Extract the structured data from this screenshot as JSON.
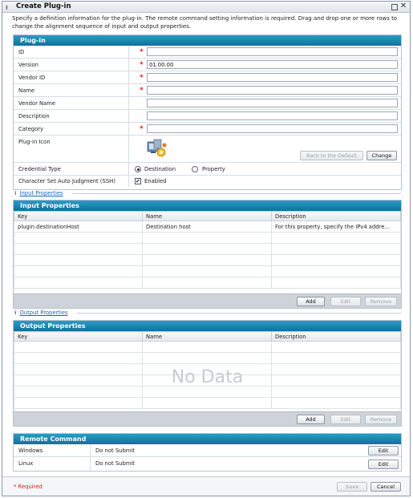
{
  "dialog": {
    "title": "Create Plug-in",
    "instructions": "Specify a definition information for the plug-in. The remote command setting information is required. Drag and drop one or more rows to change the alignment sequence of input and output properties."
  },
  "plugin_section": {
    "title": "Plug-in",
    "fields": {
      "id": {
        "label": "ID",
        "value": ""
      },
      "version": {
        "label": "Version",
        "value": "01.00.00"
      },
      "vendor_id": {
        "label": "Vendor ID",
        "value": ""
      },
      "name": {
        "label": "Name",
        "value": ""
      },
      "vendor_name": {
        "label": "Vendor Name",
        "value": ""
      },
      "description": {
        "label": "Description",
        "value": ""
      },
      "category": {
        "label": "Category",
        "value": ""
      }
    },
    "required_mark": "*",
    "icon": {
      "label": "Plug-in Icon",
      "back_default": "Back to the Default",
      "change": "Change"
    },
    "credential": {
      "label": "Credential Type",
      "options": [
        "Destination",
        "Property"
      ],
      "selected": "Destination"
    },
    "charset": {
      "label": "Character Set Auto Judgment (SSH)",
      "option": "Enabled",
      "checked": true
    }
  },
  "input_link": "Input Properties",
  "input_section": {
    "title": "Input Properties",
    "columns": [
      "Key",
      "Name",
      "Description"
    ],
    "rows": [
      [
        "plugin.destinationHost",
        "Destination host",
        "For this property, specify the IPv4 addre..."
      ]
    ],
    "add": "Add",
    "edit": "Edit",
    "remove": "Remove"
  },
  "output_link": "Output Properties",
  "output_section": {
    "title": "Output Properties",
    "columns": [
      "Key",
      "Name",
      "Description"
    ],
    "empty_text": "No Data",
    "add": "Add",
    "edit": "Edit",
    "remove": "Remove"
  },
  "remote_section": {
    "title": "Remote Command",
    "rows": [
      {
        "os": "Windows",
        "value": "Do not Submit",
        "action": "Edit"
      },
      {
        "os": "Linux",
        "value": "Do not Submit",
        "action": "Edit"
      }
    ]
  },
  "footer": {
    "required_note": "* Required",
    "save": "Save",
    "cancel": "Cancel"
  }
}
